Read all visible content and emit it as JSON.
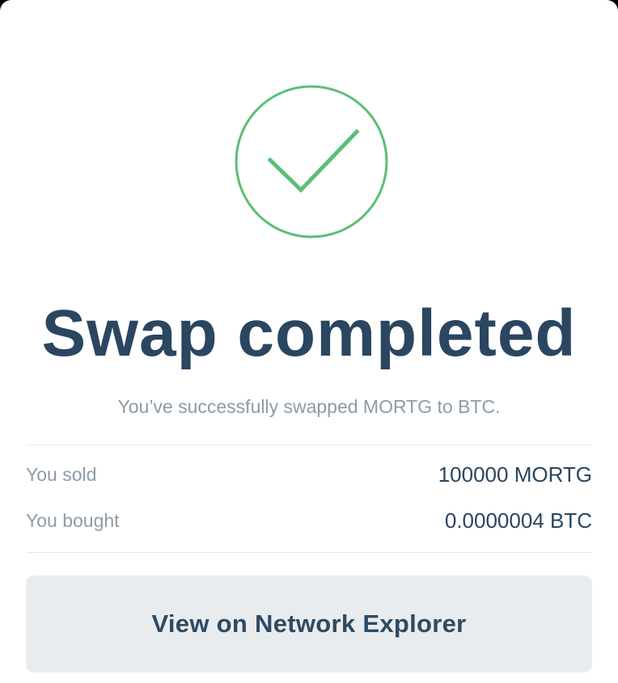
{
  "modal": {
    "icon": "check-circle-icon",
    "title": "Swap completed",
    "subtitle": "You’ve successfully swapped MORTG to BTC.",
    "accent_color": "#5bbf75"
  },
  "summary": {
    "rows": [
      {
        "label": "You sold",
        "value": "100000 MORTG"
      },
      {
        "label": "You bought",
        "value": "0.0000004 BTC"
      }
    ]
  },
  "actions": {
    "explorer_label": "View on Network Explorer"
  }
}
